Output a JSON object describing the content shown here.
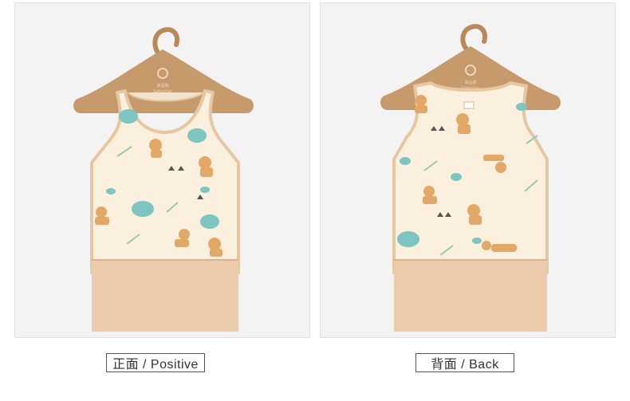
{
  "captions": {
    "front": "正面 / Positive",
    "back": "背面 / Back"
  },
  "hanger_brand": {
    "line1": "某品牌",
    "line2": "Gebenlan"
  },
  "colors": {
    "background": "#ffffff",
    "panel": "#f3f3f3",
    "hanger": "#c69a6b",
    "vest_body": "#fbefdd",
    "vest_trim": "#e6c7a4",
    "print_tiger": "#e2a865",
    "print_leaf": "#7cc5c0"
  },
  "icons": [
    "tiger-icon",
    "leaf-icon"
  ]
}
